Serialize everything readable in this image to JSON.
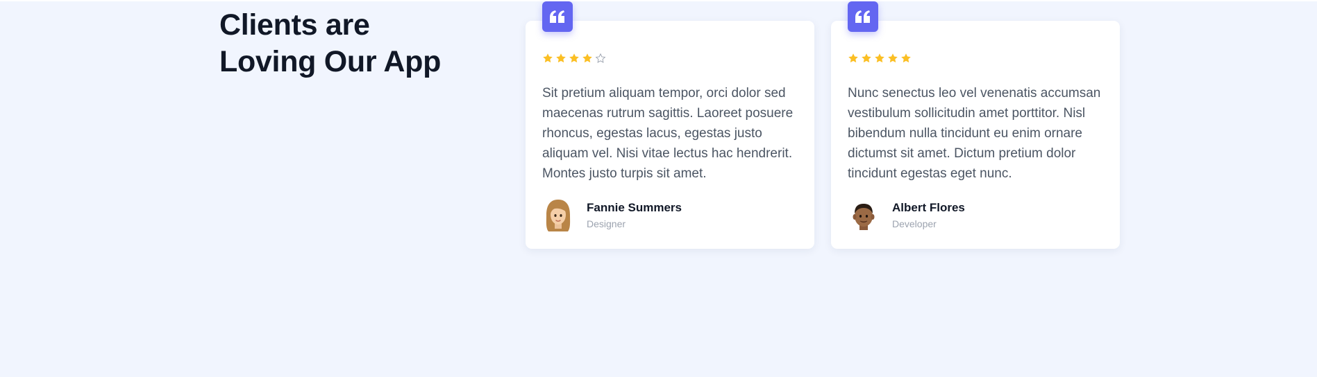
{
  "section": {
    "heading": "Clients are Loving Our App"
  },
  "colors": {
    "background": "#f1f5fe",
    "accent": "#6366f1",
    "star": "#fbbf24",
    "star_empty": "#9ca3af"
  },
  "testimonials": [
    {
      "rating": 4,
      "max_rating": 5,
      "text": "Sit pretium aliquam tempor, orci dolor sed maecenas rutrum sagittis. Laoreet posuere rhoncus, egestas lacus, egestas justo aliquam vel. Nisi vitae lectus hac hendrerit. Montes justo turpis sit amet.",
      "name": "Fannie Summers",
      "role": "Designer",
      "avatar_icon": "female-memoji-avatar"
    },
    {
      "rating": 5,
      "max_rating": 5,
      "text": "Nunc senectus leo vel venenatis accumsan vestibulum sollicitudin amet porttitor. Nisl bibendum nulla tincidunt eu enim ornare dictumst sit amet. Dictum pretium dolor tincidunt egestas eget nunc.",
      "name": "Albert Flores",
      "role": "Developer",
      "avatar_icon": "male-memoji-avatar"
    }
  ]
}
